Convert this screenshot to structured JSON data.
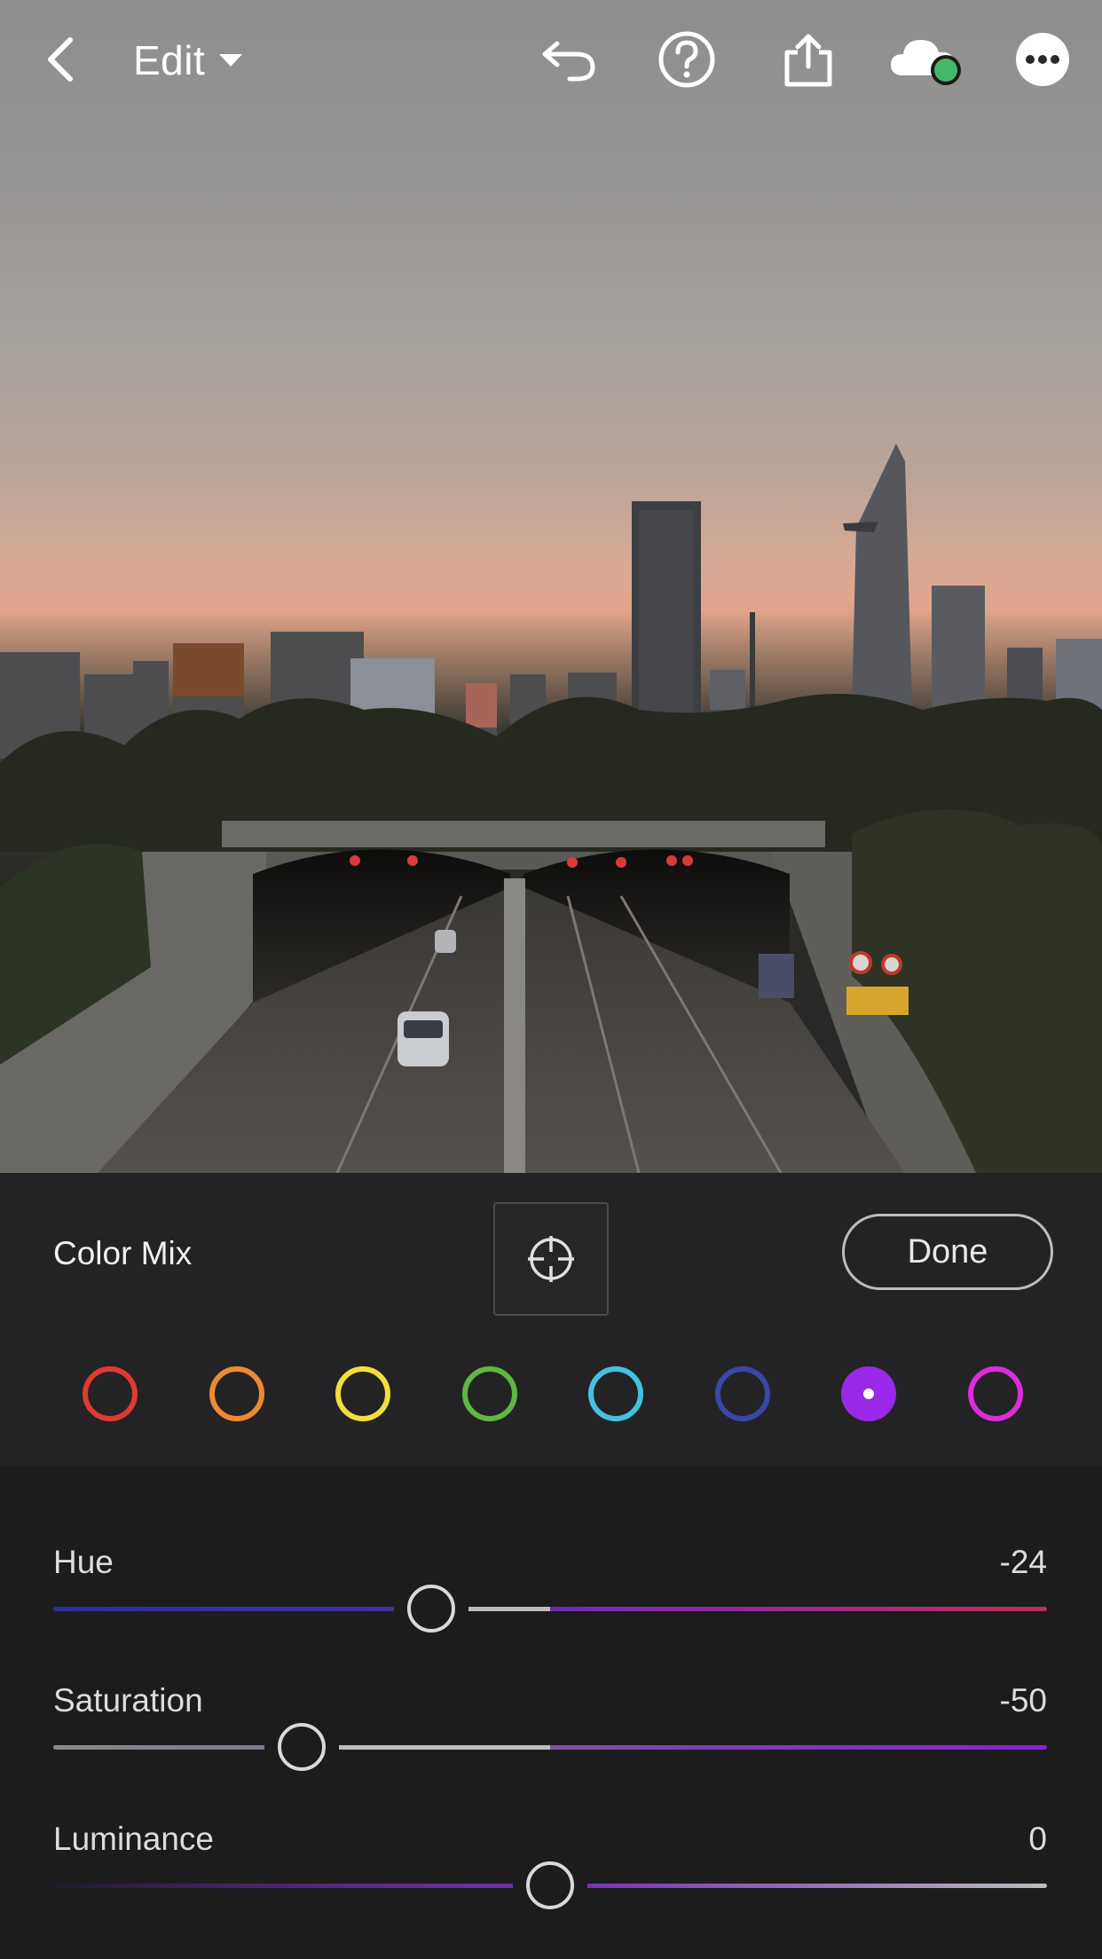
{
  "header": {
    "back_icon": "chevron-left-icon",
    "edit_label": "Edit",
    "edit_dropdown_icon": "caret-down-icon",
    "undo_icon": "undo-icon",
    "help_icon": "help-icon",
    "share_icon": "share-icon",
    "cloud_icon": "cloud-sync-icon",
    "cloud_status_color": "#43b86a",
    "more_icon": "more-icon"
  },
  "panel": {
    "title": "Color Mix",
    "target_icon": "target-adjust-icon",
    "done_label": "Done"
  },
  "color_swatches": [
    {
      "name": "red",
      "color": "#e03a33",
      "selected": false
    },
    {
      "name": "orange",
      "color": "#ee8a30",
      "selected": false
    },
    {
      "name": "yellow",
      "color": "#f2df3a",
      "selected": false
    },
    {
      "name": "green",
      "color": "#62b541",
      "selected": false
    },
    {
      "name": "aqua",
      "color": "#45c1e0",
      "selected": false
    },
    {
      "name": "blue",
      "color": "#3a46a8",
      "selected": false
    },
    {
      "name": "purple",
      "color": "#9a28e8",
      "selected": true
    },
    {
      "name": "magenta",
      "color": "#dd2cdc",
      "selected": false
    }
  ],
  "sliders": [
    {
      "label": "Hue",
      "value": "-24",
      "min": -100,
      "max": 100,
      "numeric": -24
    },
    {
      "label": "Saturation",
      "value": "-50",
      "min": -100,
      "max": 100,
      "numeric": -50
    },
    {
      "label": "Luminance",
      "value": "0",
      "min": -100,
      "max": 100,
      "numeric": 0
    }
  ]
}
